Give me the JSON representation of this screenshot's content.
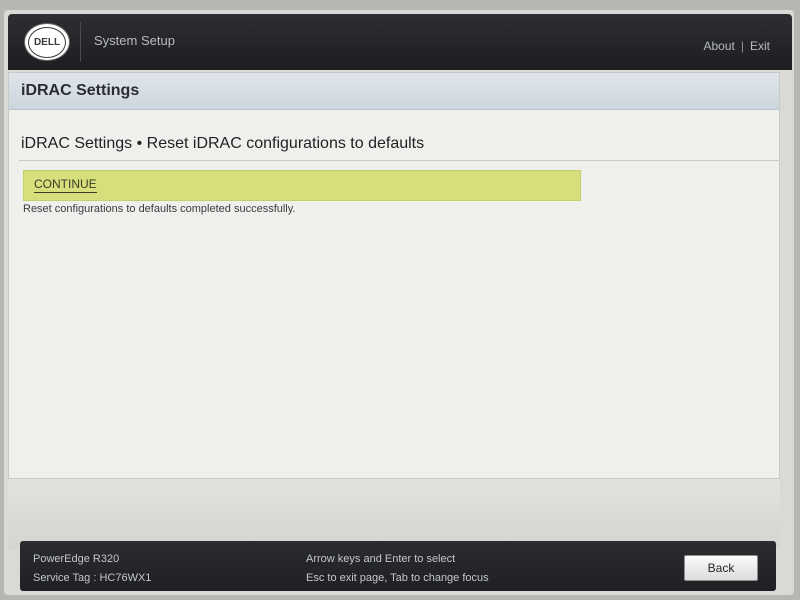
{
  "header": {
    "logo_text": "DELL",
    "app_title": "System Setup",
    "about_label": "About",
    "separator": "|",
    "exit_label": "Exit"
  },
  "section": {
    "title": "iDRAC Settings"
  },
  "page": {
    "title": "iDRAC Settings • Reset iDRAC configurations to defaults",
    "continue_label": "CONTINUE",
    "status_message": "Reset configurations to defaults completed successfully."
  },
  "footer": {
    "model": "PowerEdge R320",
    "service_tag": "Service Tag : HC76WX1",
    "hint_line1": "Arrow keys and Enter to select",
    "hint_line2": "Esc to exit page, Tab to change focus",
    "back_label": "Back"
  },
  "colors": {
    "header_bg": "#222428",
    "section_bar_bg": "#cdd6de",
    "highlight_bg": "#d6df7b",
    "panel_bg": "#efefec"
  }
}
